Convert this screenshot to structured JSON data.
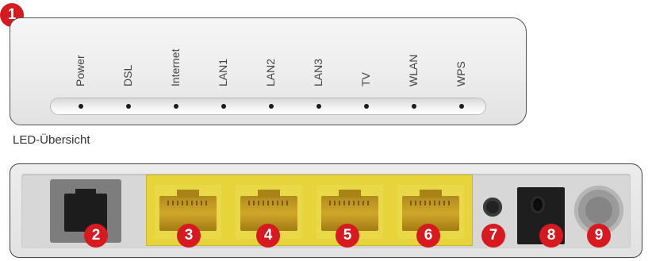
{
  "top_panel": {
    "badge": "1",
    "led_labels": [
      "Power",
      "DSL",
      "Internet",
      "LAN1",
      "LAN2",
      "LAN3",
      "TV",
      "WLAN",
      "WPS"
    ],
    "caption": "LED-Übersicht"
  },
  "rear_panel": {
    "badges": [
      "2",
      "3",
      "4",
      "5",
      "6",
      "7",
      "8",
      "9"
    ]
  },
  "colors": {
    "badge": "#d71920",
    "lan_port": "#e6d43a",
    "panel": "#ececec"
  }
}
